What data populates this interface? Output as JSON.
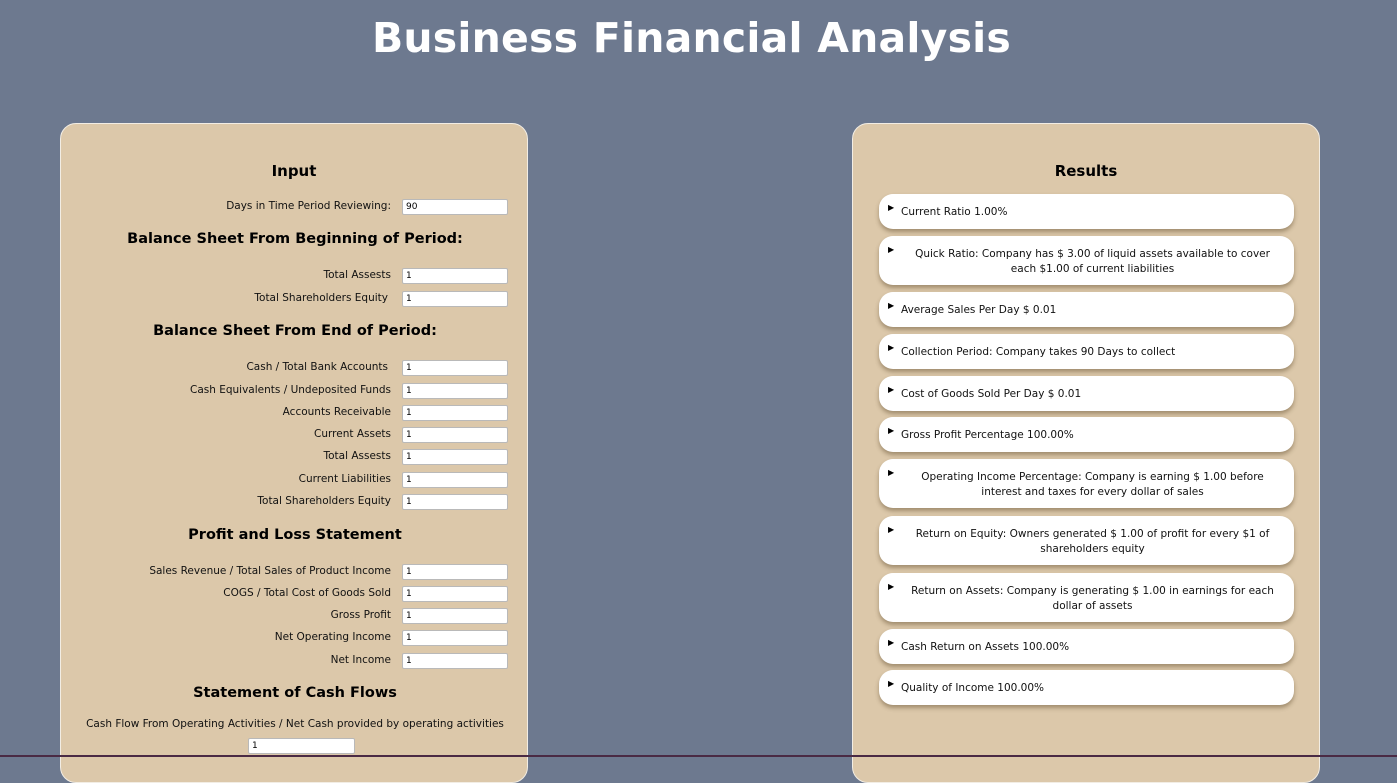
{
  "title": "Business Financial Analysis",
  "input": {
    "heading": "Input",
    "days": {
      "label": "Days in Time Period Reviewing:",
      "value": "90"
    },
    "beginning": {
      "heading": "Balance Sheet From Beginning of Period:",
      "total_assets": {
        "label": "Total Assests",
        "value": "1"
      },
      "total_equity": {
        "label": "Total Shareholders Equity",
        "value": "1"
      }
    },
    "end": {
      "heading": "Balance Sheet From End of Period:",
      "cash": {
        "label": "Cash / Total Bank Accounts",
        "value": "1"
      },
      "cash_equiv": {
        "label": "Cash Equivalents / Undeposited Funds",
        "value": "1"
      },
      "receivable": {
        "label": "Accounts Receivable",
        "value": "1"
      },
      "current_assets": {
        "label": "Current Assets",
        "value": "1"
      },
      "total_assets": {
        "label": "Total Assests",
        "value": "1"
      },
      "current_liabilities": {
        "label": "Current Liabilities",
        "value": "1"
      },
      "total_equity": {
        "label": "Total Shareholders Equity",
        "value": "1"
      }
    },
    "pl": {
      "heading": "Profit and Loss Statement",
      "sales": {
        "label": "Sales Revenue / Total Sales of Product Income",
        "value": "1"
      },
      "cogs": {
        "label": "COGS / Total Cost of Goods Sold",
        "value": "1"
      },
      "gross_profit": {
        "label": "Gross Profit",
        "value": "1"
      },
      "net_operating": {
        "label": "Net Operating Income",
        "value": "1"
      },
      "net_income": {
        "label": "Net Income",
        "value": "1"
      }
    },
    "cashflows": {
      "heading": "Statement of Cash Flows",
      "operating": {
        "label": "Cash Flow From Operating Activities / Net Cash provided by operating activities",
        "value": "1"
      }
    }
  },
  "results": {
    "heading": "Results",
    "items": [
      "Current Ratio 1.00%",
      "Quick Ratio: Company has $ 3.00 of liquid assets available to cover each $1.00 of current liabilities",
      "Average Sales Per Day $ 0.01",
      "Collection Period: Company takes 90 Days to collect",
      "Cost of Goods Sold Per Day $ 0.01",
      "Gross Profit Percentage 100.00%",
      "Operating Income Percentage: Company is earning $ 1.00 before interest and taxes for every dollar of sales",
      "Return on Equity: Owners generated $ 1.00 of profit for every $1 of shareholders equity",
      "Return on Assets: Company is generating $ 1.00 in earnings for each dollar of assets",
      "Cash Return on Assets 100.00%",
      "Quality of Income 100.00%"
    ]
  }
}
